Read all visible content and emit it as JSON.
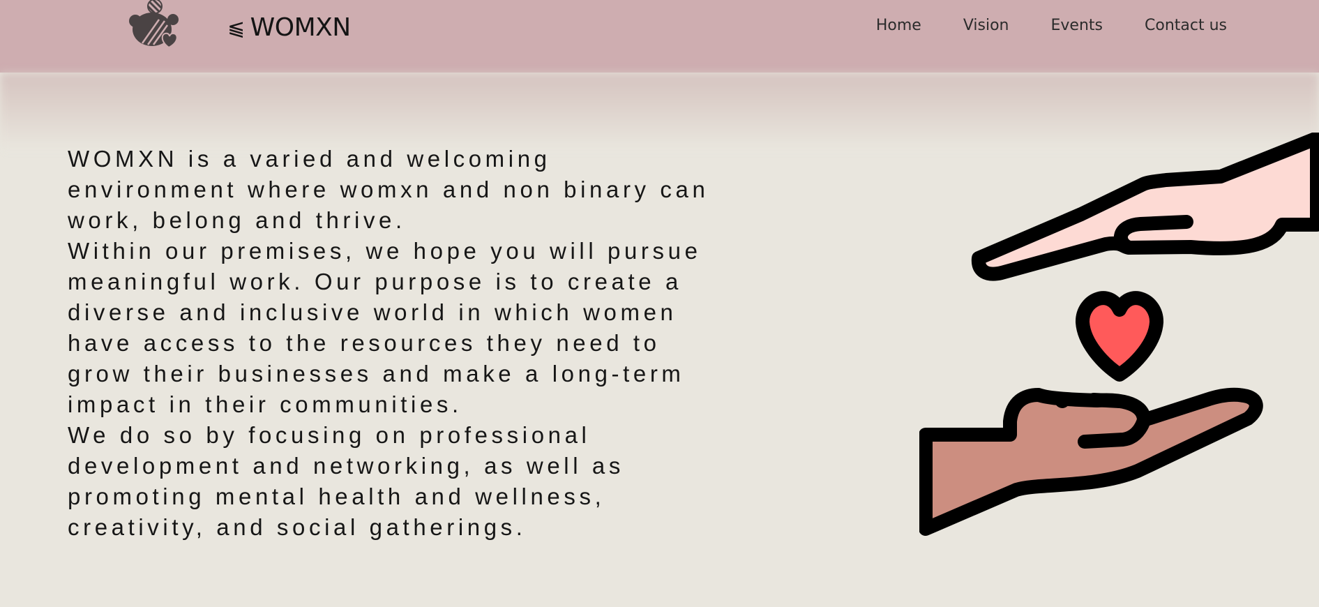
{
  "header": {
    "brand_mark": "⫹",
    "brand_name": "WOMXN",
    "nav": [
      {
        "label": "Home"
      },
      {
        "label": "Vision"
      },
      {
        "label": "Events"
      },
      {
        "label": "Contact us"
      }
    ]
  },
  "main": {
    "paragraphs": [
      "WOMXN is a varied and welcoming environment where womxn and non binary can work, belong and thrive.",
      "Within our premises, we hope you will pursue meaningful work. Our purpose is to create a diverse and inclusive world in which women have access to the resources they need to grow their businesses and make a long-term impact in their communities.",
      "We do so by focusing on professional development and networking, as well as promoting mental health and wellness, creativity, and social gatherings."
    ]
  },
  "icons": {
    "logo": "womxn-logo-icon",
    "illustration": "hands-heart-icon"
  },
  "colors": {
    "navbar": "#ceadb0",
    "background": "#e9e6de",
    "heart": "#ff5a5a",
    "top_hand": "#fddad4",
    "bottom_hand": "#cc8e80"
  }
}
